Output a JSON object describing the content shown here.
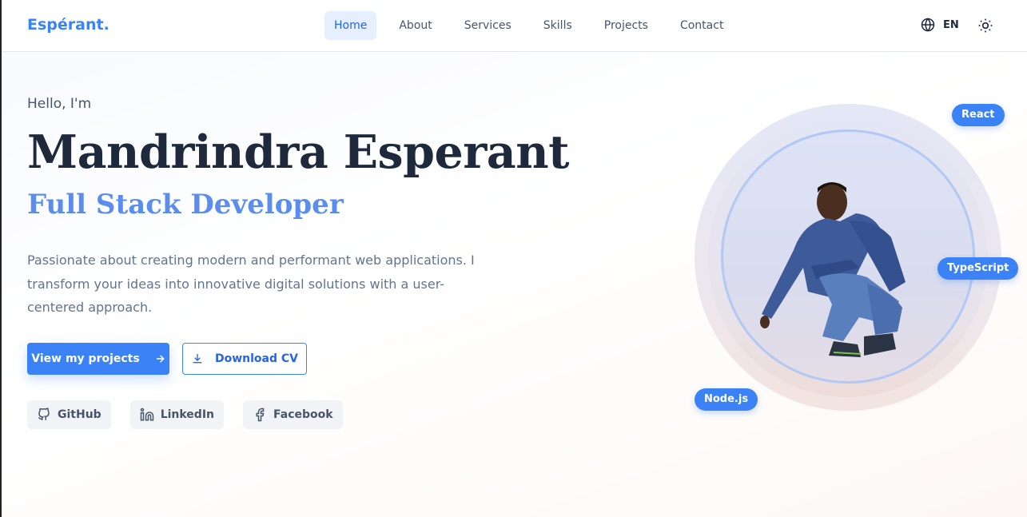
{
  "nav": {
    "logo": "Espérant.",
    "links": [
      "Home",
      "About",
      "Services",
      "Skills",
      "Projects",
      "Contact"
    ],
    "language": "EN",
    "icons": {
      "language": "globe-icon",
      "theme": "sun-icon"
    }
  },
  "hero": {
    "greeting": "Hello, I'm",
    "name": "Mandrindra Esperant",
    "role": "Full Stack Developer",
    "description": "Passionate about creating modern and performant web applications. I transform your ideas into innovative digital solutions with a user-centered approach.",
    "primary_button": "View my projects",
    "secondary_button": "Download CV",
    "socials": [
      {
        "label": "GitHub",
        "icon": "github-icon"
      },
      {
        "label": "LinkedIn",
        "icon": "linkedin-icon"
      },
      {
        "label": "Facebook",
        "icon": "facebook-icon"
      }
    ],
    "tech_tags": [
      "React",
      "TypeScript",
      "Node.js"
    ]
  },
  "colors": {
    "accent": "#3b82f6",
    "text_dark": "#1e293b",
    "text_muted": "#64748b",
    "role_color": "#5b8def"
  }
}
